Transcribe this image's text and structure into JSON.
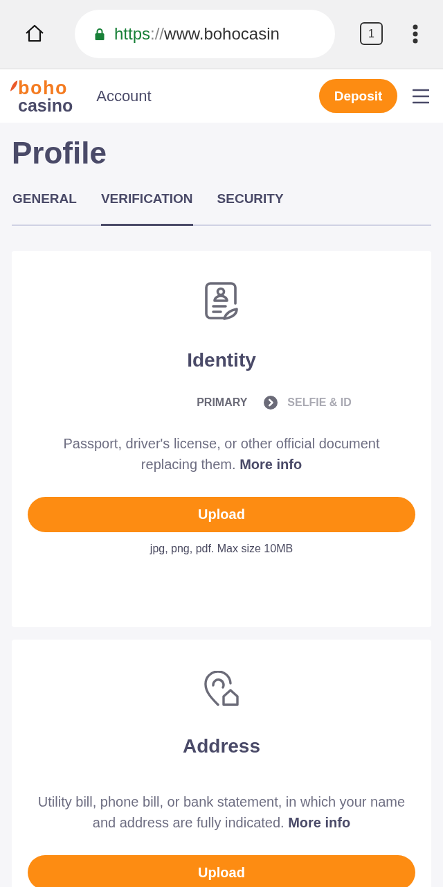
{
  "browser": {
    "url": {
      "scheme": "https",
      "separator": "://",
      "rest": "www.bohocasin"
    },
    "tab_count": "1"
  },
  "header": {
    "logo": {
      "top": "boho",
      "bottom": "casino"
    },
    "title": "Account",
    "deposit_button": "Deposit"
  },
  "page": {
    "title": "Profile",
    "tabs": [
      {
        "label": "GENERAL",
        "selected": false
      },
      {
        "label": "VERIFICATION",
        "selected": true
      },
      {
        "label": "SECURITY",
        "selected": false
      }
    ]
  },
  "cards": [
    {
      "kind": "identity",
      "title": "Identity",
      "steps": [
        {
          "label": "PRIMARY",
          "active": true
        },
        {
          "label": "SELFIE & ID",
          "active": false
        }
      ],
      "description": "Passport, driver's license, or other official document replacing them.",
      "link": "More info",
      "button": "Upload",
      "hint": "jpg, png, pdf. Max size 10MB"
    },
    {
      "kind": "address",
      "title": "Address",
      "description": "Utility bill, phone bill, or bank statement, in which your name and address are fully indicated.",
      "link": "More info",
      "button": "Upload"
    }
  ]
}
